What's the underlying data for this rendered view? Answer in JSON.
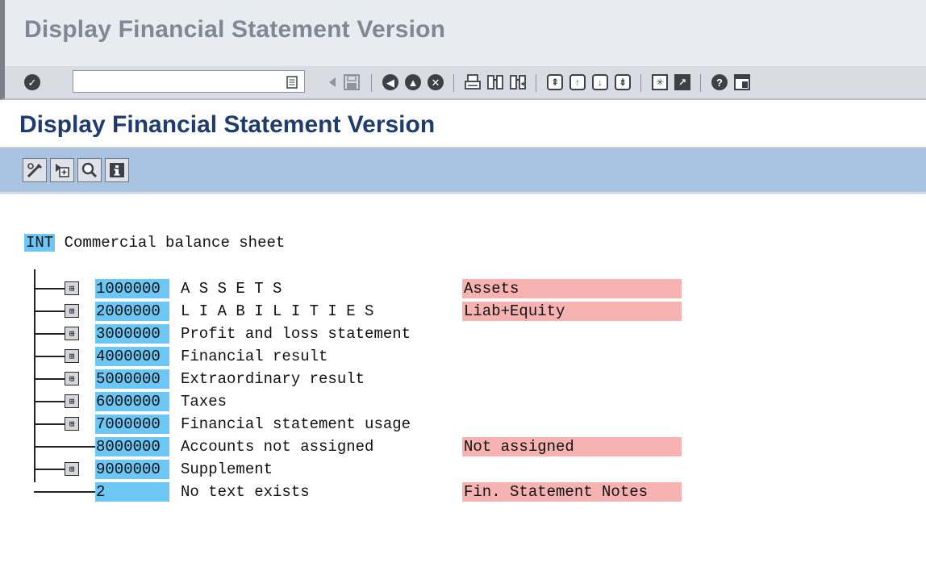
{
  "window": {
    "title": "Display Financial Statement Version"
  },
  "std_toolbar": {
    "okcode_value": "",
    "icons": [
      "enter-icon",
      "okcode-history-icon",
      "back-arrow-icon",
      "save-icon",
      "back-icon",
      "exit-icon",
      "cancel-icon",
      "print-icon",
      "find-icon",
      "find-next-icon",
      "first-page-icon",
      "previous-page-icon",
      "next-page-icon",
      "last-page-icon",
      "create-session-icon",
      "shortcut-icon",
      "help-icon",
      "layout-menu-icon"
    ]
  },
  "screen": {
    "title": "Display Financial Statement Version"
  },
  "app_toolbar": {
    "buttons": [
      "change-display-icon",
      "expand-subtree-icon",
      "find-icon",
      "information-icon"
    ]
  },
  "tree": {
    "root": {
      "key": "INT",
      "text": "Commercial balance sheet"
    },
    "nodes": [
      {
        "key": "1000000",
        "text": "A S S E T S",
        "flag": "Assets",
        "expandable": true,
        "expander": "⊞"
      },
      {
        "key": "2000000",
        "text": "L I A B I L I T I E S",
        "flag": "Liab+Equity",
        "expandable": true,
        "expander": "⊞"
      },
      {
        "key": "3000000",
        "text": "Profit and loss statement",
        "flag": "",
        "expandable": true,
        "expander": "⊞"
      },
      {
        "key": "4000000",
        "text": "Financial result",
        "flag": "",
        "expandable": true,
        "expander": "⊞"
      },
      {
        "key": "5000000",
        "text": "Extraordinary result",
        "flag": "",
        "expandable": true,
        "expander": "⊞"
      },
      {
        "key": "6000000",
        "text": "Taxes",
        "flag": "",
        "expandable": true,
        "expander": "⊞"
      },
      {
        "key": "7000000",
        "text": "Financial statement usage",
        "flag": "",
        "expandable": true,
        "expander": "⊞"
      },
      {
        "key": "8000000",
        "text": "Accounts not assigned",
        "flag": "Not assigned",
        "expandable": false,
        "expander": ""
      },
      {
        "key": "9000000",
        "text": "Supplement",
        "flag": "",
        "expandable": true,
        "expander": "⊞"
      },
      {
        "key": "2",
        "text": "No text exists",
        "flag": "Fin. Statement Notes",
        "expandable": false,
        "expander": ""
      }
    ]
  },
  "colors": {
    "key_highlight": "#6cc7f5",
    "flag_highlight": "#f6b3b1",
    "title_dark_blue": "#1f3c6e",
    "app_toolbar_blue": "#a9c3e3"
  }
}
